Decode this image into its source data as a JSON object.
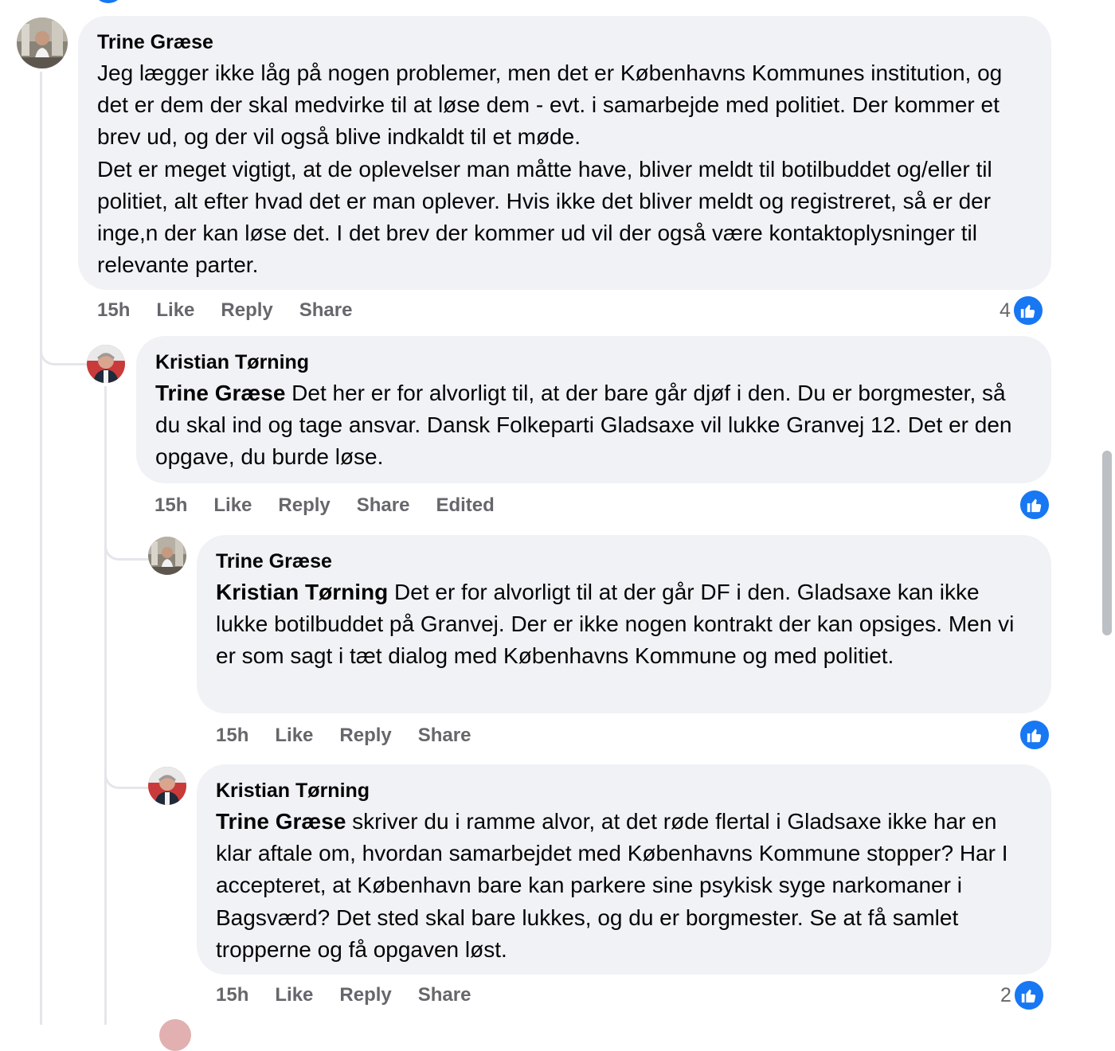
{
  "comments": [
    {
      "author": "Trine Græse",
      "paragraphs": [
        "Jeg lægger ikke låg på nogen problemer, men det er Københavns Kommunes institution, og det er dem der skal medvirke til at løse dem - evt. i samarbejde med politiet. Der kommer et brev ud, og der vil også blive indkaldt til et møde.",
        "Det er meget vigtigt, at de oplevelser man måtte have, bliver meldt til botilbuddet og/eller til politiet, alt efter hvad det er man oplever. Hvis ikke det bliver meldt og registreret, så er der inge,n der kan løse det. I det brev der kommer ud vil der også være kontaktoplysninger til relevante parter."
      ],
      "time": "15h",
      "like": "Like",
      "reply": "Reply",
      "share": "Share",
      "reaction_count": "4",
      "reaction_icon": "thumbs-up-icon"
    },
    {
      "author": "Kristian Tørning",
      "mention": "Trine Græse",
      "text": " Det her er for alvorligt til, at der bare går djøf i den. Du er borgmester, så du skal ind og tage ansvar. Dansk Folkeparti Gladsaxe vil lukke Granvej 12. Det er den opgave, du burde løse.",
      "time": "15h",
      "like": "Like",
      "reply": "Reply",
      "share": "Share",
      "edited": "Edited",
      "reaction_count": "",
      "reaction_icon": "thumbs-up-icon"
    },
    {
      "author": "Trine Græse",
      "mention": "Kristian Tørning",
      "text": " Det er for alvorligt til at der går DF i den. Gladsaxe kan ikke lukke botilbuddet på Granvej. Der er ikke nogen kontrakt der kan opsiges. Men vi er som sagt i tæt dialog med Københavns Kommune og med politiet.",
      "time": "15h",
      "like": "Like",
      "reply": "Reply",
      "share": "Share",
      "reaction_count": "",
      "reaction_icon": "thumbs-up-icon"
    },
    {
      "author": "Kristian Tørning",
      "mention": "Trine Græse",
      "text": " skriver du i ramme alvor, at det røde flertal i Gladsaxe ikke har en klar aftale om, hvordan samarbejdet med Københavns Kommune stopper? Har I accepteret, at København bare kan parkere sine psykisk syge narkomaner i Bagsværd? Det sted skal bare lukkes, og du er borgmester. Se at få samlet tropperne og få opgaven løst.",
      "time": "15h",
      "like": "Like",
      "reply": "Reply",
      "share": "Share",
      "reaction_count": "2",
      "reaction_icon": "thumbs-up-icon"
    }
  ],
  "colors": {
    "bubble": "#f0f2f5",
    "like_blue": "#1877f2",
    "meta_gray": "#65676b",
    "thread_line": "#e4e6eb"
  }
}
